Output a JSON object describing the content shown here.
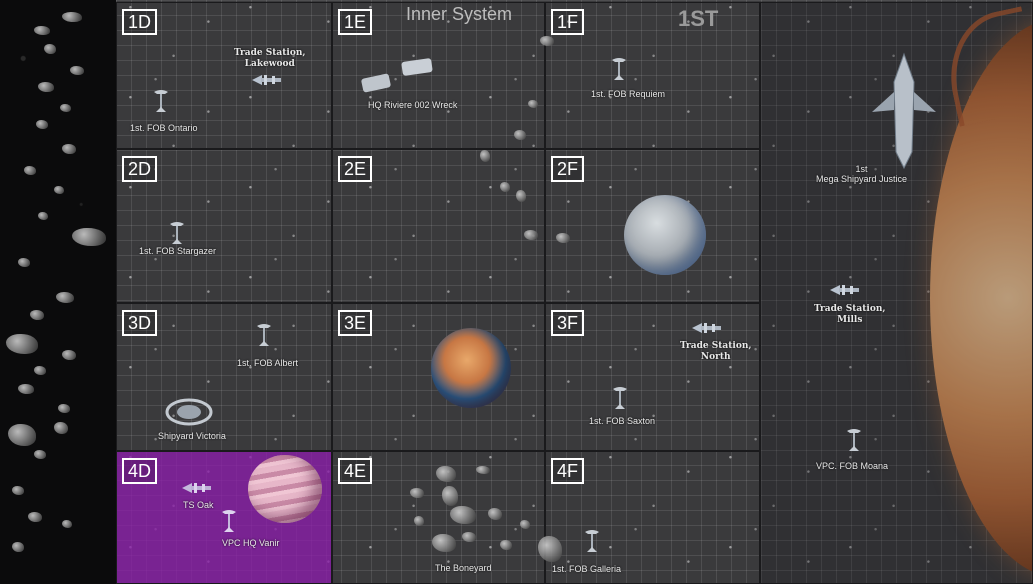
{
  "map": {
    "headers": {
      "inner_system": "Inner System",
      "sector_group": "1ST"
    },
    "sectors": {
      "s1D": "1D",
      "s1E": "1E",
      "s1F": "1F",
      "s2D": "2D",
      "s2E": "2E",
      "s2F": "2F",
      "s3D": "3D",
      "s3E": "3E",
      "s3F": "3F",
      "s4D": "4D",
      "s4E": "4E",
      "s4F": "4F"
    },
    "locations": {
      "trade_station_lakewood": "Trade Station,\nLakewood",
      "fob_ontario": "1st. FOB Ontario",
      "hq_riviere_wreck": "HQ Riviere 002 Wreck",
      "fob_requiem": "1st. FOB Requiem",
      "fob_stargazer": "1st. FOB Stargazer",
      "fob_albert": "1st. FOB Albert",
      "shipyard_victoria": "Shipyard Victoria",
      "trade_station_north": "Trade Station,\nNorth",
      "fob_saxton": "1st. FOB Saxton",
      "ts_oak": "TS Oak",
      "vpc_hq_vanir": "VPC HQ Vanir",
      "the_boneyard": "The Boneyard",
      "fob_galleria": "1st. FOB Galleria",
      "mega_shipyard_justice": "1st\nMega Shipyard Justice",
      "trade_station_mills": "Trade Station,\nMills",
      "vpc_fob_moana": "VPC. FOB Moana"
    },
    "colors": {
      "purple_sector": "#8c1eaa",
      "grid": "#3a3a3c",
      "sun": "#d8925a"
    },
    "icons": {
      "fob": "fob-tower-icon",
      "station": "trade-station-icon",
      "shipyard": "shipyard-icon",
      "planet": "planet-icon",
      "asteroid": "asteroid-icon",
      "sun": "sun-icon"
    }
  }
}
